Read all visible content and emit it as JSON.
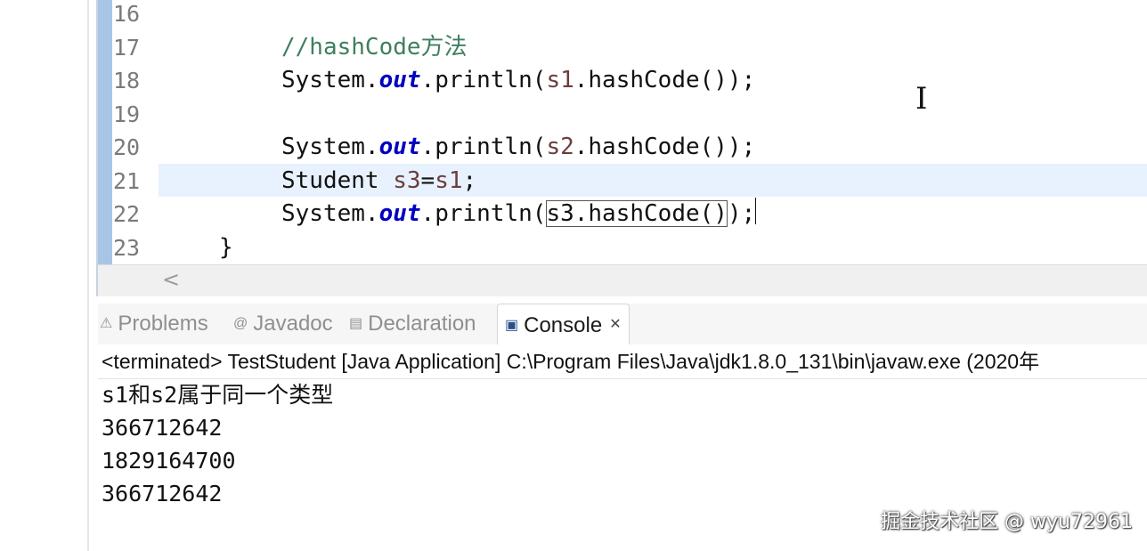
{
  "editor": {
    "lines": [
      {
        "no": "16",
        "segments": []
      },
      {
        "no": "17",
        "segments": [
          {
            "t": "//hashCode方法",
            "c": "comment"
          }
        ]
      },
      {
        "no": "18",
        "segments": [
          {
            "t": "System.",
            "c": ""
          },
          {
            "t": "out",
            "c": "field"
          },
          {
            "t": ".println(",
            "c": ""
          },
          {
            "t": "s1",
            "c": "local"
          },
          {
            "t": ".hashCode());",
            "c": ""
          }
        ]
      },
      {
        "no": "19",
        "segments": []
      },
      {
        "no": "20",
        "segments": [
          {
            "t": "System.",
            "c": ""
          },
          {
            "t": "out",
            "c": "field"
          },
          {
            "t": ".println(",
            "c": ""
          },
          {
            "t": "s2",
            "c": "local"
          },
          {
            "t": ".hashCode());",
            "c": ""
          }
        ]
      },
      {
        "no": "21",
        "segments": [
          {
            "t": "Student ",
            "c": ""
          },
          {
            "t": "s3",
            "c": "local"
          },
          {
            "t": "=",
            "c": ""
          },
          {
            "t": "s1",
            "c": "local"
          },
          {
            "t": ";",
            "c": ""
          }
        ]
      },
      {
        "no": "22",
        "segments": [
          {
            "t": "System.",
            "c": ""
          },
          {
            "t": "out",
            "c": "field"
          },
          {
            "t": ".println(",
            "c": ""
          },
          {
            "t": "s3.hashCode()",
            "c": "boxed"
          },
          {
            "t": ");",
            "c": ""
          }
        ]
      },
      {
        "no": "23",
        "segments": [
          {
            "t": "}",
            "c": ""
          }
        ]
      }
    ],
    "scroll_left_arrow": "<"
  },
  "console": {
    "tabs": [
      {
        "label": "Problems",
        "icon": "problems-icon",
        "glyph": "⚠",
        "active": false
      },
      {
        "label": "Javadoc",
        "icon": "javadoc-icon",
        "glyph": "@",
        "active": false
      },
      {
        "label": "Declaration",
        "icon": "declaration-icon",
        "glyph": "▤",
        "active": false
      },
      {
        "label": "Console",
        "icon": "console-icon",
        "glyph": "▣",
        "active": true
      }
    ],
    "close_glyph": "✕",
    "status": "<terminated> TestStudent [Java Application] C:\\Program Files\\Java\\jdk1.8.0_131\\bin\\javaw.exe (2020年",
    "output": [
      "s1和s2属于同一个类型",
      "366712642",
      "1829164700",
      "366712642"
    ]
  },
  "watermark": "掘金技术社区 @ wyu72961"
}
